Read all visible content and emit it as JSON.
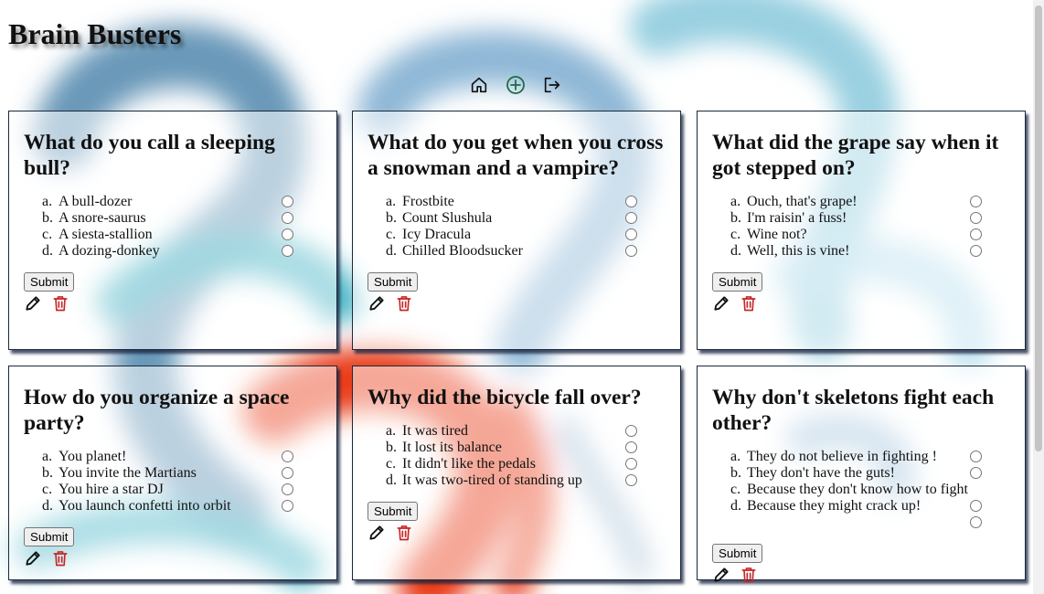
{
  "app": {
    "title": "Brain Busters"
  },
  "nav": {
    "items": [
      {
        "name": "home",
        "icon": "home-icon"
      },
      {
        "name": "add-question",
        "icon": "plus-circle-icon",
        "color": "#1f7a4a"
      },
      {
        "name": "logout",
        "icon": "logout-icon"
      }
    ]
  },
  "colors": {
    "delete": "#c62828",
    "edit": "#111111",
    "bg_blue": "#6aa0c8",
    "bg_teal": "#3fb0c4",
    "bg_red": "#e8340e",
    "bg_light": "#a8d8ea"
  },
  "submit_label": "Submit",
  "cards": [
    {
      "question": "What do you call a sleeping bull?",
      "answers": [
        {
          "letter": "a.",
          "text": "A bull-dozer"
        },
        {
          "letter": "b.",
          "text": "A snore-saurus"
        },
        {
          "letter": "c.",
          "text": "A siesta-stallion"
        },
        {
          "letter": "d.",
          "text": "A dozing-donkey"
        }
      ]
    },
    {
      "question": "What do you get when you cross a snowman and a vampire?",
      "answers": [
        {
          "letter": "a.",
          "text": "Frostbite"
        },
        {
          "letter": "b.",
          "text": "Count Slushula"
        },
        {
          "letter": "c.",
          "text": "Icy Dracula"
        },
        {
          "letter": "d.",
          "text": "Chilled Bloodsucker"
        }
      ]
    },
    {
      "question": "What did the grape say when it got stepped on?",
      "answers": [
        {
          "letter": "a.",
          "text": "Ouch, that's grape!"
        },
        {
          "letter": "b.",
          "text": "I'm raisin' a fuss!"
        },
        {
          "letter": "c.",
          "text": "Wine not?"
        },
        {
          "letter": "d.",
          "text": "Well, this is vine!"
        }
      ]
    },
    {
      "question": "How do you organize a space party?",
      "answers": [
        {
          "letter": "a.",
          "text": "You planet!"
        },
        {
          "letter": "b.",
          "text": "You invite the Martians"
        },
        {
          "letter": "c.",
          "text": "You hire a star DJ"
        },
        {
          "letter": "d.",
          "text": "You launch confetti into orbit"
        }
      ]
    },
    {
      "question": "Why did the bicycle fall over?",
      "answers": [
        {
          "letter": "a.",
          "text": "It was tired"
        },
        {
          "letter": "b.",
          "text": "It lost its balance"
        },
        {
          "letter": "c.",
          "text": "It didn't like the pedals"
        },
        {
          "letter": "d.",
          "text": "It was two-tired of standing up"
        }
      ]
    },
    {
      "question": "Why don't skeletons fight each other?",
      "answers": [
        {
          "letter": "a.",
          "text": "They do not believe in fighting !"
        },
        {
          "letter": "b.",
          "text": "They don't have the guts!"
        },
        {
          "letter": "c.",
          "text": "Because they don't know how to fight",
          "no_radio": true
        },
        {
          "letter": "d.",
          "text": "Because they might crack up!"
        }
      ],
      "extra_radio": true
    }
  ]
}
